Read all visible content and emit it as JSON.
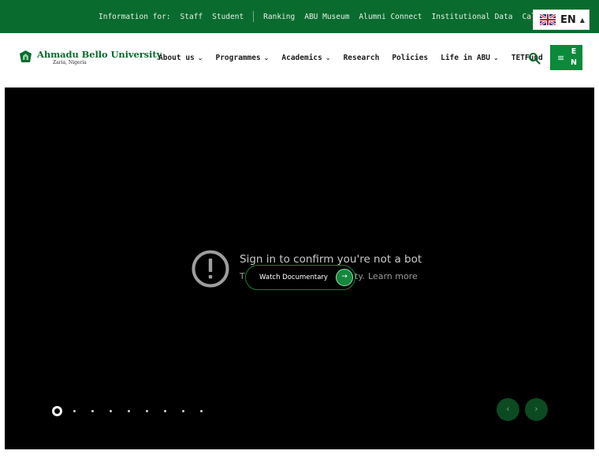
{
  "topbar": {
    "info_label": "Information for:",
    "audience_links": [
      "Staff",
      "Student"
    ],
    "links": [
      "Ranking",
      "ABU Museum",
      "Alumni Connect",
      "Institutional Data",
      "Calendar"
    ],
    "language": {
      "code": "EN",
      "flag": "uk-flag-icon"
    }
  },
  "header": {
    "logo": {
      "name": "Ahmadu Bello University",
      "location": "Zaria, Nigeria"
    },
    "nav": [
      {
        "label": "About us",
        "dropdown": true
      },
      {
        "label": "Programmes",
        "dropdown": true
      },
      {
        "label": "Academics",
        "dropdown": true
      },
      {
        "label": "Research",
        "dropdown": false
      },
      {
        "label": "Policies",
        "dropdown": false
      },
      {
        "label": "Life in ABU",
        "dropdown": true
      },
      {
        "label": "TETFund",
        "dropdown": false
      }
    ],
    "menu_button": {
      "letters": [
        "E",
        "N"
      ]
    }
  },
  "hero": {
    "notice_title": "Sign in to confirm you're not a bot",
    "notice_sub": "T",
    "notice_sub_suffix": "ity.",
    "learn_more": "Learn more",
    "watch_label": "Watch Documentary",
    "slides_total": 9,
    "active_slide": 1
  },
  "colors": {
    "brand_green": "#0a6b2e",
    "button_green": "#0a8a3a"
  }
}
